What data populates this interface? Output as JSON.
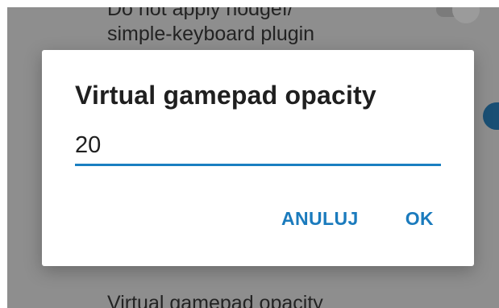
{
  "background": {
    "items": [
      {
        "label_line1": "Do not apply nodgef/",
        "label_line2": "simple-keyboard plugin"
      },
      {
        "label": "Virtual gamepad opacity"
      }
    ]
  },
  "dialog": {
    "title": "Virtual gamepad opacity",
    "input_value": "20",
    "cancel_label": "ANULUJ",
    "ok_label": "OK"
  },
  "colors": {
    "accent": "#1b7bbd",
    "scrim": "#8e8e8e",
    "toggle_on": "#1a4f74"
  }
}
